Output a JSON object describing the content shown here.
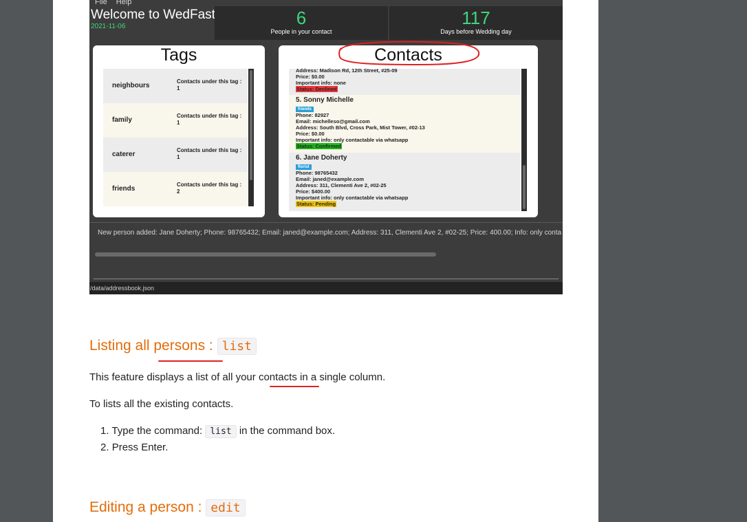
{
  "app": {
    "menu": [
      "File",
      "Help"
    ],
    "welcome": "Welcome to WedFast!",
    "date": "2021-11-06",
    "stats": [
      {
        "value": "6",
        "label": "People in your contact"
      },
      {
        "value": "117",
        "label": "Days before Wedding day"
      }
    ],
    "tags_title": "Tags",
    "contacts_title": "Contacts",
    "tags": [
      {
        "name": "neighbours",
        "count_label": "Contacts under this tag :",
        "count": "1"
      },
      {
        "name": "family",
        "count_label": "Contacts under this tag :",
        "count": "1"
      },
      {
        "name": "caterer",
        "count_label": "Contacts under this tag :",
        "count": "1"
      },
      {
        "name": "friends",
        "count_label": "Contacts under this tag :",
        "count": "2"
      }
    ],
    "partial_contact": {
      "address": "Address: Madison Rd, 12th Street, #25-09",
      "price": "Price: $0.00",
      "info": "Important info: none",
      "status": "Status: Declined"
    },
    "contacts": [
      {
        "name": "5.  Sonny Michelle",
        "tag": "friends",
        "phone": "Phone: 82927",
        "email": "Email: michelleso@gmail.com",
        "address": "Address: South Blvd, Cross Park, Mist Tower, #02-13",
        "price": "Price: $0.00",
        "info": "Important info: only contactable via whatsapp",
        "status": "Status: Confirmed"
      },
      {
        "name": "6.  Jane Doherty",
        "tag": "florist",
        "phone": "Phone: 98765432",
        "email": "Email: janed@example.com",
        "address": "Address: 311, Clementi Ave 2, #02-25",
        "price": "Price: $400.00",
        "info": "Important info: only contactable via whatsapp",
        "status": "Status: Pending"
      }
    ],
    "result": "New person added: Jane Doherty; Phone: 98765432; Email: janed@example.com; Address: 311, Clementi Ave 2, #02-25; Price: 400.00; Info: only conta",
    "footer": "/data/addressbook.json"
  },
  "doc": {
    "section1": {
      "heading": "Listing all persons :",
      "command": "list",
      "desc_before": "This feature displays a list of all your ",
      "desc_highlight": "contacts in",
      "desc_after": " a single column.",
      "intro": "To lists all the existing contacts.",
      "step1_num": "1.",
      "step1_before": "Type the command:",
      "step1_code": "list",
      "step1_after": "in the command box.",
      "step2_num": "2.",
      "step2": "Press Enter."
    },
    "section2": {
      "heading": "Editing a person :",
      "command": "edit"
    }
  },
  "colors": {
    "heading": "#e46c0a",
    "accent_green": "#3fd67e",
    "annotation_red": "#e02020",
    "status_declined": "#e8383d",
    "status_confirmed": "#1db81d",
    "status_pending": "#f2c200",
    "tag_chip": "#2a9fd6"
  }
}
